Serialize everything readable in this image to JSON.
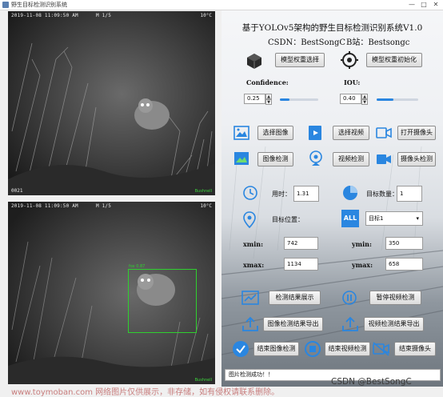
{
  "window": {
    "title": "野生目标检测识别系统",
    "controls": [
      "—",
      "□",
      "✕"
    ]
  },
  "camera_top": {
    "timestamp": "2019-11-08 11:09:50 AM",
    "info": "M 1/5",
    "temp": "10°C",
    "counter": "0021",
    "brand": "Bushnell"
  },
  "camera_bottom": {
    "timestamp": "2019-11-08 11:09:50 AM",
    "info": "M 1/5",
    "temp": "10°C",
    "detection_label": "fox 0.87",
    "brand": "Bushnell"
  },
  "panel": {
    "title": "基于YOLOv5架构的野生目标检测识别系统V1.0",
    "csdn": "CSDN：BestSongC",
    "bili": "B站：Bestsongc",
    "model_select_label": "模型权重选择",
    "model_init_label": "模型权重初始化",
    "confidence_label": "Confidence:",
    "confidence_value": "0.25",
    "iou_label": "IOU:",
    "iou_value": "0.40",
    "confidence_level": 0.25,
    "iou_level": 0.4,
    "buttons": {
      "select_image": "选择图像",
      "select_video": "选择视频",
      "open_camera": "打开摄像头",
      "image_detect": "图像检测",
      "video_detect": "视频检测",
      "camera_detect": "摄像头检测",
      "show_results": "检测结果展示",
      "pause_video": "暂停视频检测",
      "export_image": "图像检测结果导出",
      "export_video": "视频检测结果导出",
      "end_image": "结束图像检测",
      "end_video": "结束视频检测",
      "end_camera": "结束摄像头"
    },
    "time_label": "用时：",
    "time_value": "1.31",
    "count_label": "目标数量：",
    "count_value": "1",
    "position_label": "目标位置：",
    "target_select": "目标1",
    "xmin_label": "xmin:",
    "xmin_value": "742",
    "ymin_label": "ymin:",
    "ymin_value": "350",
    "xmax_label": "xmax:",
    "xmax_value": "1134",
    "ymax_label": "ymax:",
    "ymax_value": "658",
    "status_text": "图片检测成功！！"
  },
  "watermarks": {
    "left": "www.toymoban.com 网络图片仅供展示，非存储，如有侵权请联系删除。",
    "right": "CSDN @BestSongC"
  },
  "colors": {
    "accent_blue": "#2a86e0",
    "detection_green": "#2fd02f"
  }
}
